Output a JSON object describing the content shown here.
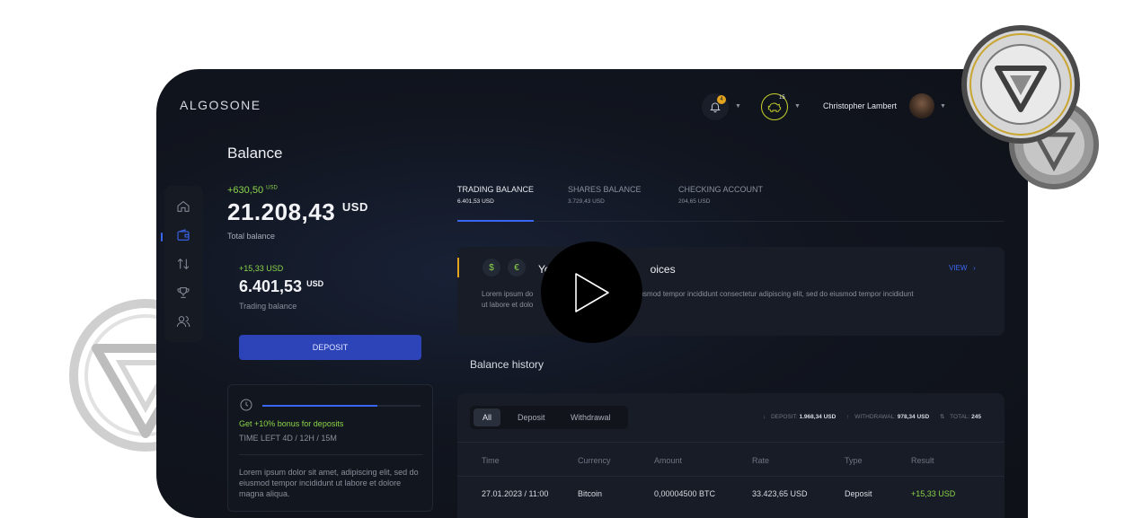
{
  "app": {
    "logo": "ALGOSONE"
  },
  "header": {
    "notifications_count": "4",
    "piggy_count": "15",
    "user_name": "Christopher Lambert"
  },
  "sidebar": {
    "items": [
      {
        "icon": "home-icon"
      },
      {
        "icon": "wallet-icon",
        "active": true
      },
      {
        "icon": "transfer-icon"
      },
      {
        "icon": "trophy-icon"
      },
      {
        "icon": "users-icon"
      }
    ]
  },
  "balance": {
    "title": "Balance",
    "total_delta": "+630,50",
    "total_delta_unit": "USD",
    "total_value": "21.208,43",
    "total_unit": "USD",
    "total_label": "Total balance",
    "trading_delta": "+15,33 USD",
    "trading_value": "6.401,53",
    "trading_unit": "USD",
    "trading_label": "Trading balance",
    "deposit_label": "DEPOSIT"
  },
  "bonus": {
    "progress": 0.73,
    "title": "Get +10% bonus for deposits",
    "time_left": "TIME LEFT 4D / 12H / 15M",
    "text": "Lorem ipsum dolor sit amet,  adipiscing elit, sed do eiusmod tempor incididunt ut labore et dolore magna aliqua."
  },
  "tabs": [
    {
      "label": "TRADING BALANCE",
      "value": "6.401,53 USD",
      "active": true
    },
    {
      "label": "SHARES BALANCE",
      "value": "3.729,43 USD"
    },
    {
      "label": "CHECKING ACCOUNT",
      "value": "204,65 USD"
    }
  ],
  "invoice": {
    "currency_symbols": [
      "$",
      "€"
    ],
    "title": "Yo",
    "title_tail": "oices",
    "view_label": "VIEW",
    "text_left": "Lorem ipsum do",
    "text_left_2": "ut labore et dolo",
    "text_right": "eiusmod tempor incididunt consectetur adipiscing elit, sed do eiusmod tempor incididunt"
  },
  "history": {
    "title": "Balance history",
    "filters": [
      "All",
      "Deposit",
      "Withdrawal"
    ],
    "active_filter": "All",
    "deposit_label": "DEPOSIT:",
    "deposit_value": "1.968,34 USD",
    "withdrawal_label": "WITHDRAWAL:",
    "withdrawal_value": "978,34 USD",
    "total_label": "TOTAL:",
    "total_value": "245",
    "columns": [
      "Time",
      "Currency",
      "Amount",
      "Rate",
      "Type",
      "Result"
    ],
    "rows": [
      [
        "27.01.2023 / 11:00",
        "Bitcoin",
        "0,00004500 BTC",
        "33.423,65 USD",
        "Deposit",
        "+15,33 USD"
      ]
    ]
  },
  "colors": {
    "accent": "#3b66f2",
    "positive": "#8bd44a",
    "warning": "#e2a31f",
    "background": "#0e1117"
  }
}
